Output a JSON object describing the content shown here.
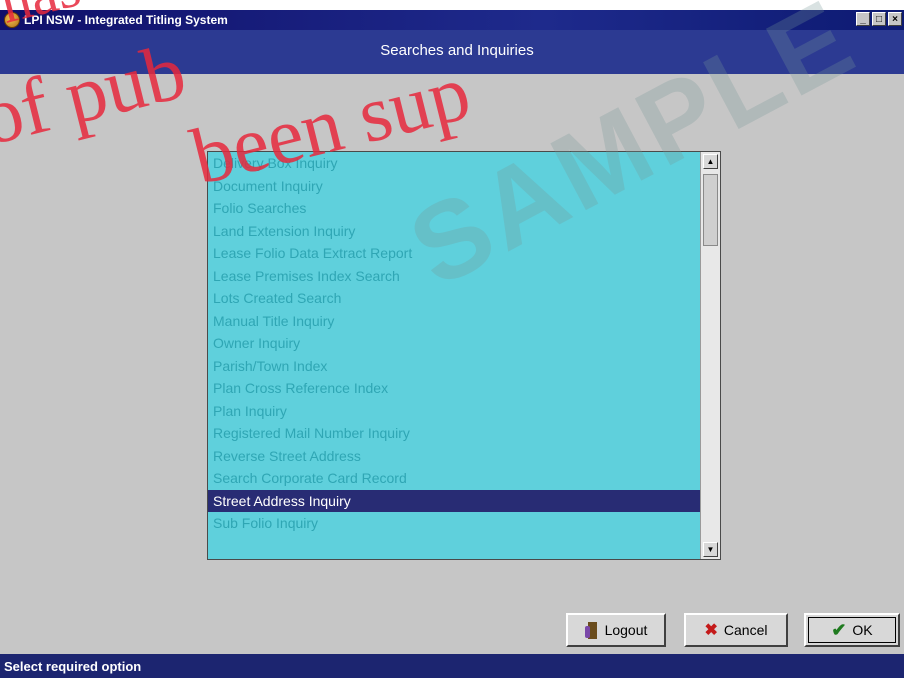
{
  "window": {
    "title": "LPI NSW - Integrated Titling System",
    "controls": [
      "_",
      "□",
      "×"
    ]
  },
  "header": {
    "title": "Searches and Inquiries"
  },
  "list": {
    "items": [
      "Delivery Box Inquiry",
      "Document Inquiry",
      "Folio Searches",
      "Land Extension Inquiry",
      "Lease Folio Data Extract Report",
      "Lease Premises Index Search",
      "Lots Created Search",
      "Manual Title Inquiry",
      "Owner Inquiry",
      "Parish/Town Index",
      "Plan Cross Reference Index",
      "Plan Inquiry",
      "Registered Mail Number Inquiry",
      "Reverse Street Address",
      "Search Corporate Card Record",
      "Street Address Inquiry",
      "Sub Folio Inquiry"
    ],
    "selected": "Street Address Inquiry"
  },
  "buttons": {
    "logout": "Logout",
    "cancel": "Cancel",
    "ok": "OK"
  },
  "status": {
    "text": "Select required option"
  },
  "watermark": {
    "text": "SAMPLE"
  },
  "stamp": {
    "lines": [
      "has",
      "of pub",
      "been sup"
    ]
  },
  "colors": {
    "list_bg": "#5fd0dc",
    "selected_bg": "#282c74",
    "header_bg": "#2c3a92",
    "status_bg": "#1c2570"
  },
  "icons": {
    "logout": "logout-door-icon",
    "cancel": "x-cross-icon",
    "ok": "check-mark-icon"
  }
}
